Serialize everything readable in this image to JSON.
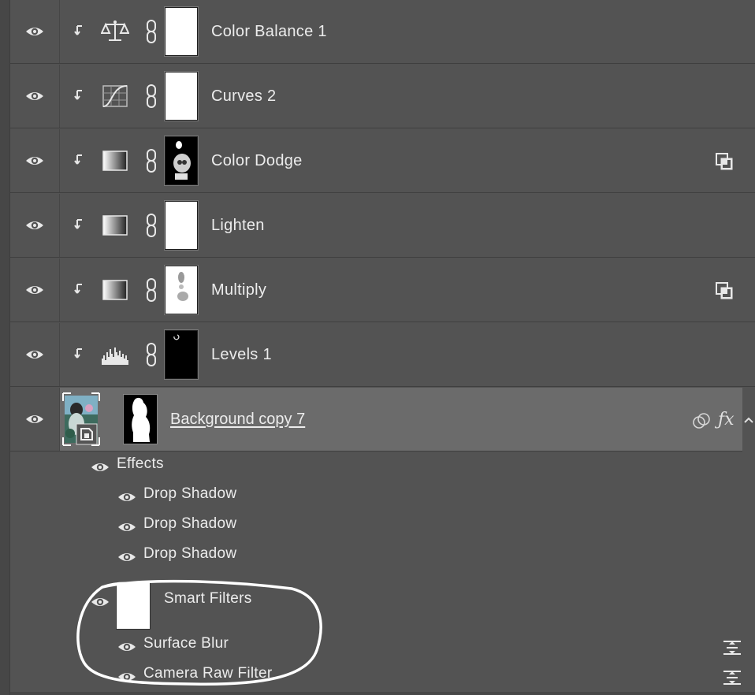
{
  "layers": [
    {
      "name": "Color Balance 1",
      "adjustment_icon": "balance-scale-icon",
      "mask": "white",
      "blend_badge": false
    },
    {
      "name": "Curves 2",
      "adjustment_icon": "curves-icon",
      "mask": "white",
      "blend_badge": false
    },
    {
      "name": "Color Dodge",
      "adjustment_icon": "gradient-fill-icon",
      "mask": "black-with-figure",
      "blend_badge": true
    },
    {
      "name": "Lighten",
      "adjustment_icon": "gradient-fill-icon",
      "mask": "white",
      "blend_badge": false
    },
    {
      "name": "Multiply",
      "adjustment_icon": "gradient-fill-icon",
      "mask": "white-with-smudge",
      "blend_badge": true
    },
    {
      "name": "Levels 1",
      "adjustment_icon": "levels-histogram-icon",
      "mask": "black",
      "blend_badge": false
    }
  ],
  "selected_layer": {
    "name": "Background copy 7",
    "effects_label": "Effects",
    "effects": [
      "Drop Shadow",
      "Drop Shadow",
      "Drop Shadow"
    ],
    "smart_filters_label": "Smart Filters",
    "filters": [
      "Surface Blur",
      "Camera Raw Filter"
    ]
  },
  "colors": {
    "panel_bg": "#535353",
    "selected_bg": "#6b6b6b",
    "text": "#ececec",
    "annotation": "#ffffff"
  }
}
